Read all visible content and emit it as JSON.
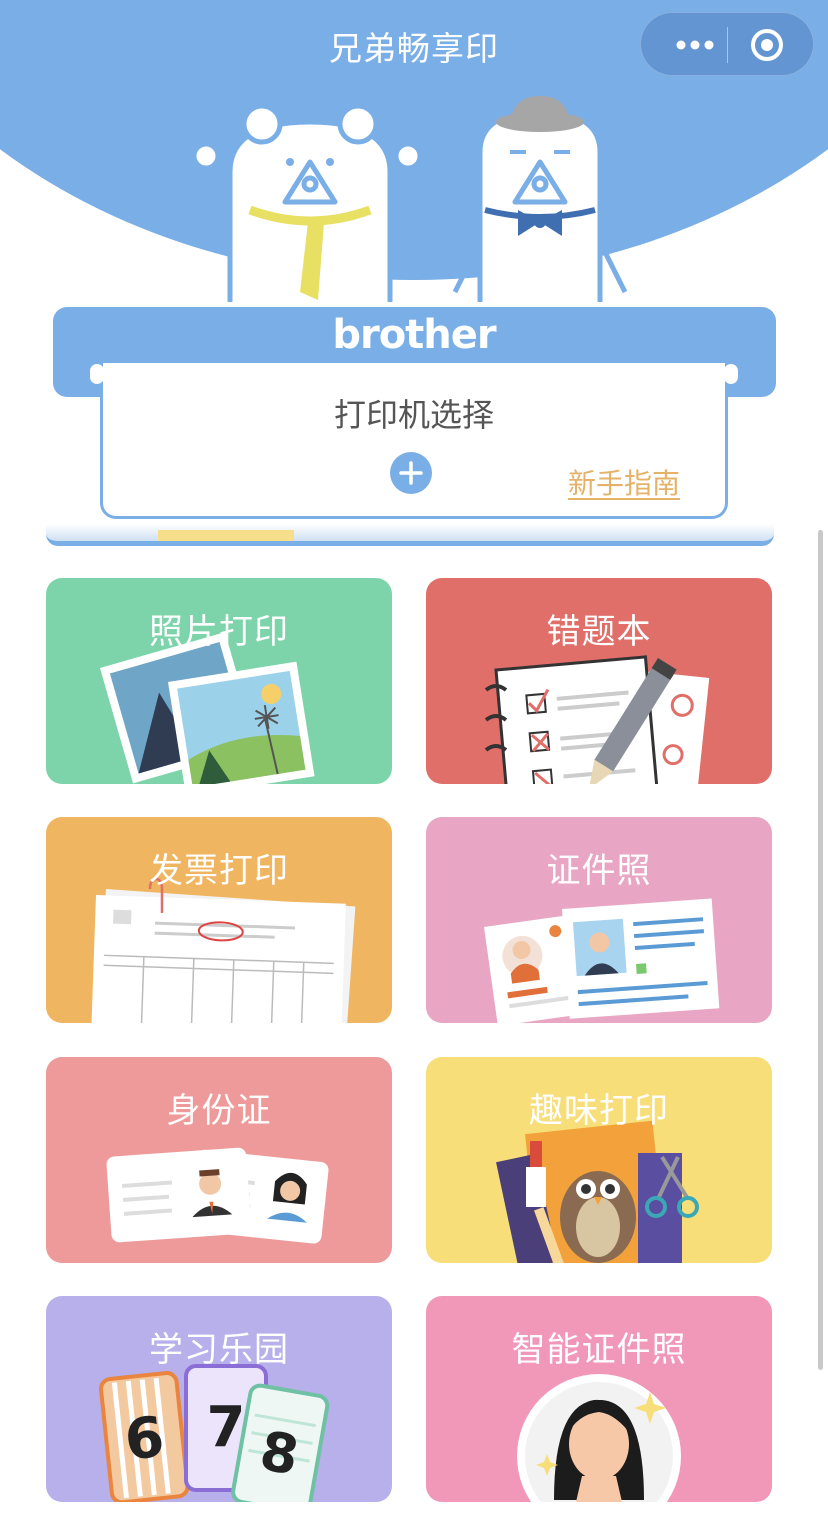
{
  "header": {
    "title": "兄弟畅享印",
    "menu_icon": "more-dots-icon",
    "close_icon": "target-circle-icon",
    "bg_color": "#7aaee6"
  },
  "printer": {
    "brand": "brother",
    "select_label": "打印机选择",
    "add_icon": "plus-icon",
    "guide_link": "新手指南"
  },
  "cards": [
    {
      "label": "照片打印",
      "color": "#7dd4aa"
    },
    {
      "label": "错题本",
      "color": "#e06f6a"
    },
    {
      "label": "发票打印",
      "color": "#efb560"
    },
    {
      "label": "证件照",
      "color": "#e8a6c4"
    },
    {
      "label": "身份证",
      "color": "#ee9a9a"
    },
    {
      "label": "趣味打印",
      "color": "#f7de78"
    },
    {
      "label": "学习乐园",
      "color": "#b7b0ea"
    },
    {
      "label": "智能证件照",
      "color": "#f197b7"
    }
  ],
  "learning_cards": [
    "6",
    "7",
    "8"
  ]
}
